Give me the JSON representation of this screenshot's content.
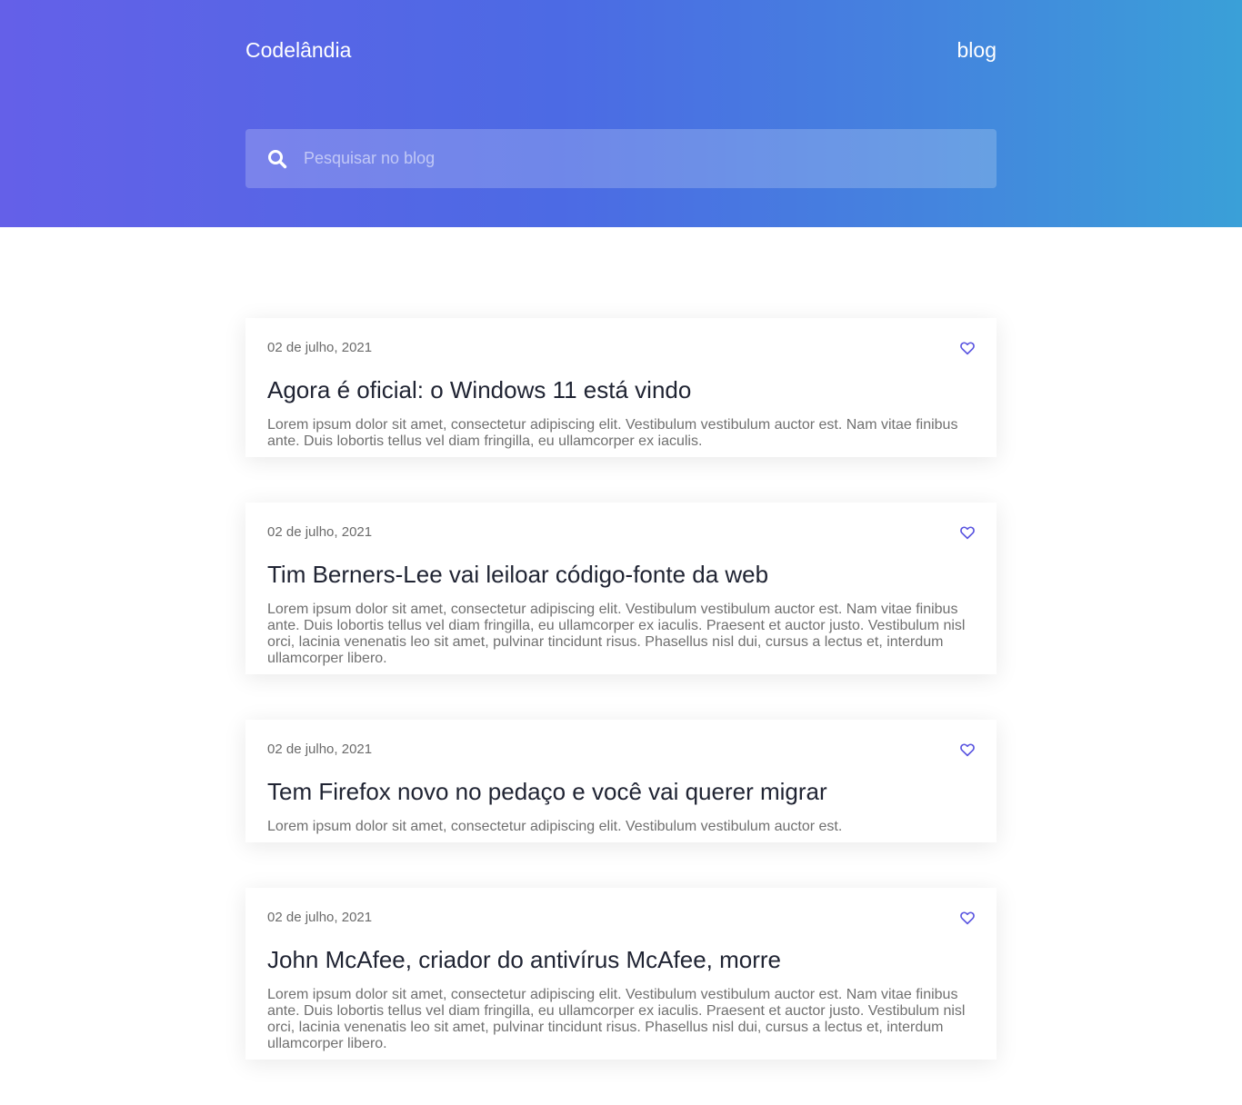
{
  "header": {
    "brand": "Codelândia",
    "nav_link": "blog"
  },
  "search": {
    "placeholder": "Pesquisar no blog",
    "value": "",
    "icon": "search-icon"
  },
  "posts": [
    {
      "date": "02 de julho, 2021",
      "title": "Agora é oficial: o Windows 11 está vindo",
      "excerpt": "Lorem ipsum dolor sit amet, consectetur adipiscing elit. Vestibulum vestibulum auctor est. Nam vitae finibus ante. Duis lobortis tellus vel diam fringilla, eu ullamcorper ex iaculis.",
      "icon": "heart-icon"
    },
    {
      "date": "02 de julho, 2021",
      "title": "Tim Berners-Lee vai leiloar código-fonte da web",
      "excerpt": "Lorem ipsum dolor sit amet, consectetur adipiscing elit. Vestibulum vestibulum auctor est. Nam vitae finibus ante. Duis lobortis tellus vel diam fringilla, eu ullamcorper ex iaculis. Praesent et auctor justo. Vestibulum nisl orci, lacinia venenatis leo sit amet, pulvinar tincidunt risus. Phasellus nisl dui, cursus a lectus et, interdum ullamcorper libero.",
      "icon": "heart-icon"
    },
    {
      "date": "02 de julho, 2021",
      "title": "Tem Firefox novo no pedaço e você vai querer migrar",
      "excerpt": "Lorem ipsum dolor sit amet, consectetur adipiscing elit. Vestibulum vestibulum auctor est.",
      "icon": "heart-icon"
    },
    {
      "date": "02 de julho, 2021",
      "title": "John McAfee, criador do antivírus McAfee, morre",
      "excerpt": "Lorem ipsum dolor sit amet, consectetur adipiscing elit. Vestibulum vestibulum auctor est. Nam vitae finibus ante. Duis lobortis tellus vel diam fringilla, eu ullamcorper ex iaculis. Praesent et auctor justo. Vestibulum nisl orci, lacinia venenatis leo sit amet, pulvinar tincidunt risus. Phasellus nisl dui, cursus a lectus et, interdum ullamcorper libero.",
      "icon": "heart-icon"
    }
  ],
  "colors": {
    "gradient_start": "#6460e8",
    "gradient_end": "#3aa0d8",
    "accent": "#5a55e0",
    "title_text": "#202433",
    "body_text": "#707070"
  }
}
